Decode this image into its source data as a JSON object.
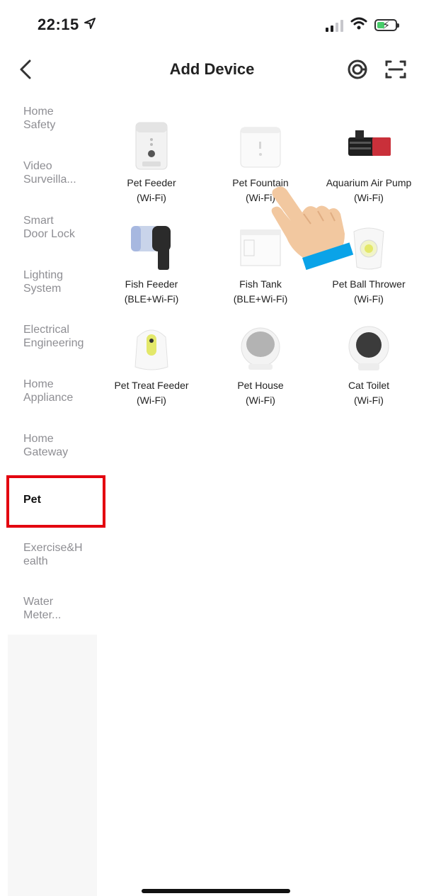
{
  "status": {
    "time": "22:15",
    "location_icon": "location-arrow-icon",
    "signal_icon": "cellular-signal-icon",
    "wifi_icon": "wifi-icon",
    "battery_icon": "battery-charging-icon"
  },
  "header": {
    "title": "Add Device",
    "back_icon": "chevron-left-icon",
    "scan_target_icon": "auto-scan-icon",
    "qr_scan_icon": "scan-frame-icon"
  },
  "sidebar": {
    "items": [
      {
        "label": "Home Safety",
        "line1": "Home",
        "line2": "Safety"
      },
      {
        "label": "Video Surveilla...",
        "line1": "Video",
        "line2": "Surveilla..."
      },
      {
        "label": "Smart Door Lock",
        "line1": "Smart",
        "line2": "Door Lock"
      },
      {
        "label": "Lighting System",
        "line1": "Lighting",
        "line2": "System"
      },
      {
        "label": "Electrical Engineering",
        "line1": "Electrical",
        "line2": "Engineering"
      },
      {
        "label": "Home Appliance",
        "line1": "Home",
        "line2": "Appliance"
      },
      {
        "label": "Home Gateway",
        "line1": "Home",
        "line2": "Gateway"
      },
      {
        "label": "Pet",
        "line1": "Pet",
        "line2": ""
      },
      {
        "label": "Exercise&Health",
        "line1": "Exercise&H",
        "line2": "ealth"
      },
      {
        "label": "Water Meter...",
        "line1": "Water",
        "line2": "Meter..."
      }
    ],
    "active": "Pet"
  },
  "devices": [
    {
      "name": "Pet Feeder",
      "protocol": "(Wi-Fi)",
      "icon": "pet-feeder-icon"
    },
    {
      "name": "Pet Fountain",
      "protocol": "(Wi-Fi)",
      "icon": "pet-fountain-icon"
    },
    {
      "name": "Aquarium Air Pump",
      "protocol": "(Wi-Fi)",
      "icon": "aquarium-air-pump-icon"
    },
    {
      "name": "Fish Feeder",
      "protocol": "(BLE+Wi-Fi)",
      "icon": "fish-feeder-icon"
    },
    {
      "name": "Fish Tank",
      "protocol": "(BLE+Wi-Fi)",
      "icon": "fish-tank-icon"
    },
    {
      "name": "Pet Ball Thrower",
      "protocol": "(Wi-Fi)",
      "icon": "pet-ball-thrower-icon"
    },
    {
      "name": "Pet Treat Feeder",
      "protocol": "(Wi-Fi)",
      "icon": "pet-treat-feeder-icon"
    },
    {
      "name": "Pet House",
      "protocol": "(Wi-Fi)",
      "icon": "pet-house-icon"
    },
    {
      "name": "Cat Toilet",
      "protocol": "(Wi-Fi)",
      "icon": "cat-toilet-icon"
    }
  ],
  "overlay": {
    "pointer_icon": "pointing-hand-icon",
    "highlight_color": "#e3000f"
  },
  "colors": {
    "accent_green": "#34c759",
    "sidebar_bg": "#f7f7f7",
    "inactive_text": "#8e8e93"
  }
}
